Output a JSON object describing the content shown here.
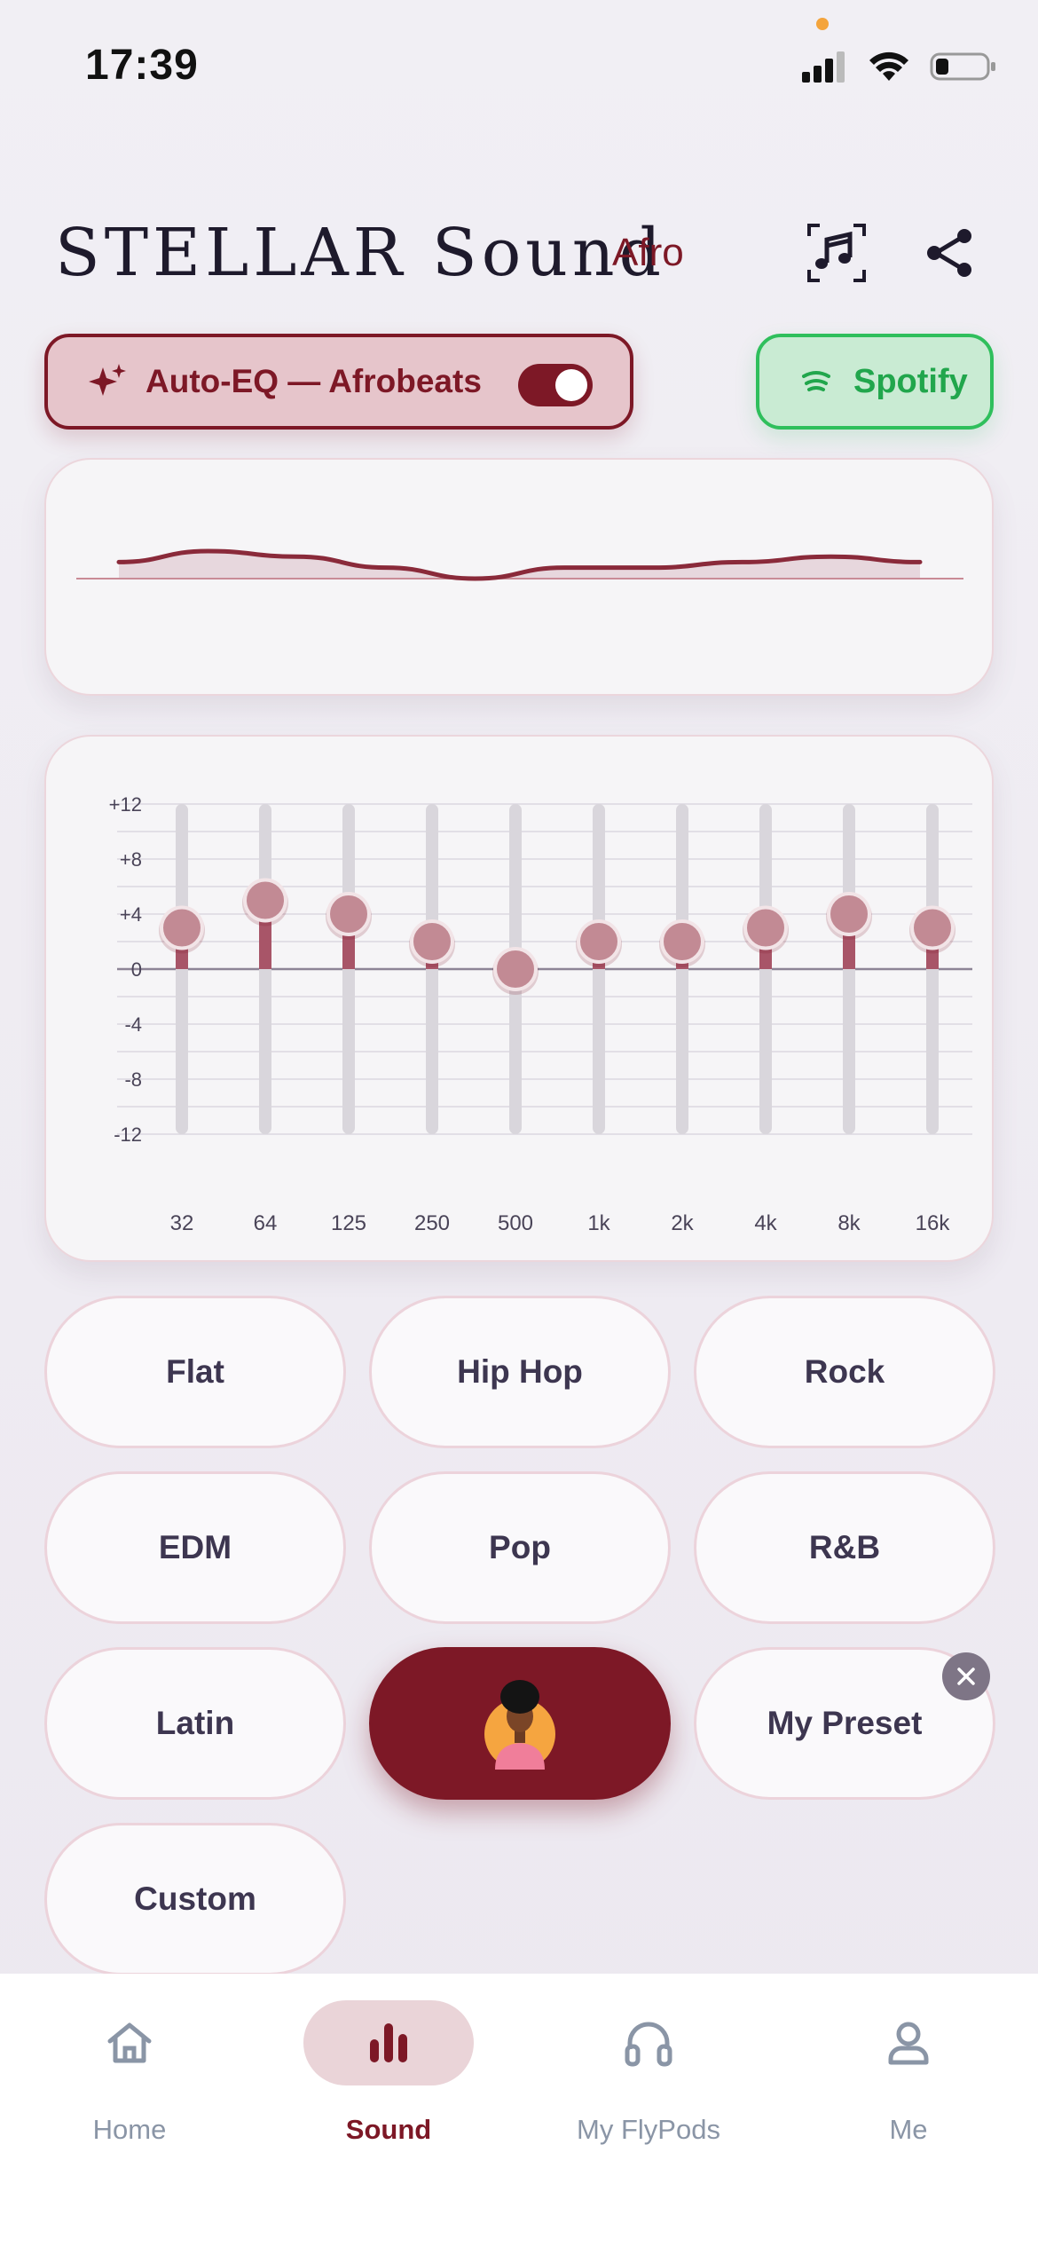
{
  "status_bar": {
    "time": "17:39"
  },
  "header": {
    "title": "STELLAR Sound",
    "subtitle": "Afro"
  },
  "auto_eq": {
    "label": "Auto-EQ — Afrobeats",
    "enabled": true
  },
  "spotify": {
    "label": "Spotify"
  },
  "equalizer": {
    "db_ticks": [
      "+12",
      "+8",
      "+4",
      "0",
      "-4",
      "-8",
      "-12"
    ],
    "range": [
      -12,
      12
    ],
    "bands": [
      {
        "label": "32",
        "gain": 3
      },
      {
        "label": "64",
        "gain": 5
      },
      {
        "label": "125",
        "gain": 4
      },
      {
        "label": "250",
        "gain": 2
      },
      {
        "label": "500",
        "gain": 0
      },
      {
        "label": "1k",
        "gain": 2
      },
      {
        "label": "2k",
        "gain": 2
      },
      {
        "label": "4k",
        "gain": 3
      },
      {
        "label": "8k",
        "gain": 4
      },
      {
        "label": "16k",
        "gain": 3
      }
    ]
  },
  "presets": [
    "Flat",
    "Hip Hop",
    "Rock",
    "EDM",
    "Pop",
    "R&B",
    "Latin",
    "",
    "My Preset",
    "Custom"
  ],
  "active_preset_index": 7,
  "nav": [
    {
      "label": "Home",
      "icon": "home-icon"
    },
    {
      "label": "Sound",
      "icon": "equalizer-bars-icon"
    },
    {
      "label": "My FlyPods",
      "icon": "headphones-icon"
    },
    {
      "label": "Me",
      "icon": "person-icon"
    }
  ],
  "active_nav_index": 1,
  "colors": {
    "accent": "#7d1826",
    "spotify": "#2fbf5c",
    "nav_inactive": "#8a95a6"
  }
}
